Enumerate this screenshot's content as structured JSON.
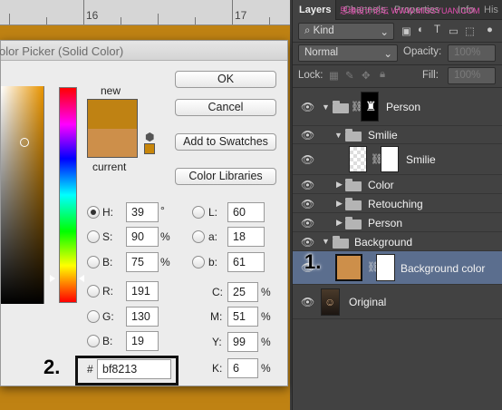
{
  "canvas": {
    "ruler_marks": [
      "16",
      "17"
    ],
    "doc_color": "#bf8213"
  },
  "dialog": {
    "title": "olor Picker (Solid Color)",
    "label_new": "new",
    "label_current": "current",
    "new_color": "#bf8213",
    "current_color": "#cd8f4a",
    "buttons": {
      "ok": "OK",
      "cancel": "Cancel",
      "add_swatches": "Add to Swatches",
      "color_libraries": "Color Libraries"
    },
    "fields": {
      "h": {
        "label": "H:",
        "value": "39",
        "unit": "°"
      },
      "s": {
        "label": "S:",
        "value": "90",
        "unit": "%"
      },
      "b": {
        "label": "B:",
        "value": "75",
        "unit": "%"
      },
      "r": {
        "label": "R:",
        "value": "191"
      },
      "g": {
        "label": "G:",
        "value": "130"
      },
      "bl": {
        "label": "B:",
        "value": "19"
      },
      "l": {
        "label": "L:",
        "value": "60"
      },
      "a": {
        "label": "a:",
        "value": "18"
      },
      "b2": {
        "label": "b:",
        "value": "61"
      },
      "c": {
        "label": "C:",
        "value": "25",
        "unit": "%"
      },
      "m": {
        "label": "M:",
        "value": "51",
        "unit": "%"
      },
      "y": {
        "label": "Y:",
        "value": "99",
        "unit": "%"
      },
      "k": {
        "label": "K:",
        "value": "6",
        "unit": "%"
      }
    },
    "hex_label": "#",
    "hex_value": "bf8213",
    "step_label": "2."
  },
  "layers_panel": {
    "tabs": {
      "layers": "Layers",
      "channels": "Channels",
      "properties": "Properties",
      "info": "Info",
      "histogram": "His"
    },
    "watermark": "思缘设计论坛 WWW.MISSYUAN.COM",
    "filter": "Kind",
    "blend_mode": "Normal",
    "opacity_label": "Opacity:",
    "opacity_value": "100%",
    "lock_label": "Lock:",
    "fill_label": "Fill:",
    "fill_value": "100%",
    "layers": [
      {
        "name": "Person"
      },
      {
        "name": "Smilie"
      },
      {
        "name": "Smilie"
      },
      {
        "name": "Color"
      },
      {
        "name": "Retouching"
      },
      {
        "name": "Person"
      },
      {
        "name": "Background"
      },
      {
        "name": "Background color"
      },
      {
        "name": "Original"
      }
    ],
    "step_label": "1."
  }
}
